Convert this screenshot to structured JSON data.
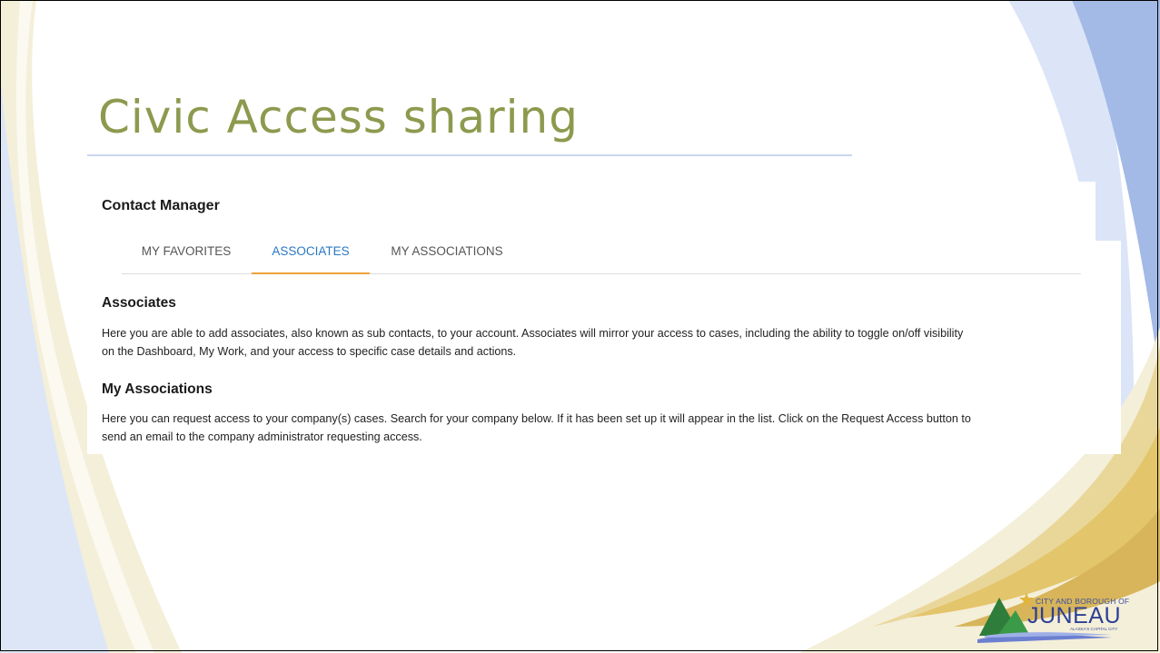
{
  "slide": {
    "title": "Civic Access sharing"
  },
  "contact_manager": {
    "title": "Contact Manager",
    "tabs": [
      {
        "label": "MY FAVORITES",
        "active": false
      },
      {
        "label": "ASSOCIATES",
        "active": true
      },
      {
        "label": "MY ASSOCIATIONS",
        "active": false
      }
    ]
  },
  "associates": {
    "heading": "Associates",
    "line1": "Here you are able to add associates, also known as sub contacts, to your account. Associates will mirror your access to cases, including the ability to toggle on/off visibility",
    "line2": "on the Dashboard, My Work, and your access to specific case details and actions."
  },
  "my_associations": {
    "heading": "My Associations",
    "line1": "Here you can request access to your company(s) cases. Search for your company below. If it has been set up it will appear in the list. Click on the Request Access button to",
    "line2": "send an email to the company administrator requesting access."
  },
  "logo": {
    "line1": "CITY AND BOROUGH OF",
    "line2": "JUNEAU",
    "line3": "ALASKA'S CAPITAL CITY"
  },
  "colors": {
    "title": "#8c9a4e",
    "active_tab_text": "#2a78c4",
    "active_tab_underline": "#f0a23a",
    "ribbon_blue": "#a3b9e6",
    "ribbon_gold": "#e3c56b"
  }
}
